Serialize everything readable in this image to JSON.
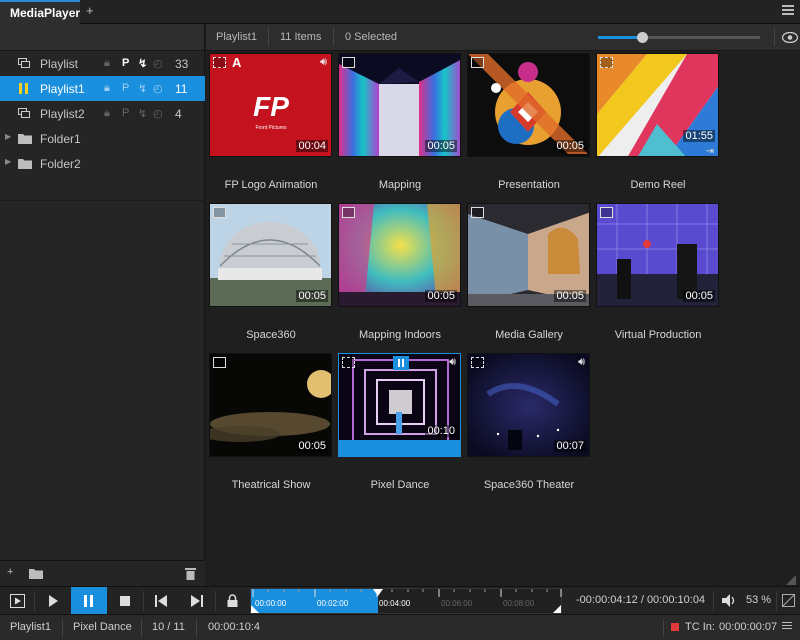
{
  "app": {
    "tab_label": "MediaPlayer",
    "add_tab": "+"
  },
  "sidebar": {
    "items": [
      {
        "label": "Playlist",
        "count": "33",
        "p": "P",
        "type": "playlist",
        "selected": false
      },
      {
        "label": "Playlist1",
        "count": "11",
        "p": "P",
        "type": "playlist-playing",
        "selected": true
      },
      {
        "label": "Playlist2",
        "count": "4",
        "p": "P",
        "type": "playlist",
        "selected": false
      },
      {
        "label": "Folder1",
        "type": "folder"
      },
      {
        "label": "Folder2",
        "type": "folder"
      }
    ]
  },
  "header": {
    "playlist_name": "Playlist1",
    "items_count": "11 Items",
    "selected_count": "0 Selected",
    "thumb_zoom": 0.27
  },
  "media": [
    {
      "title": "FP Logo Animation",
      "duration": "00:04",
      "kind": "video"
    },
    {
      "title": "Mapping",
      "duration": "00:05",
      "kind": "image"
    },
    {
      "title": "Presentation",
      "duration": "00:05",
      "kind": "image"
    },
    {
      "title": "Demo Reel",
      "duration": "01:55",
      "kind": "video"
    },
    {
      "title": "Space360",
      "duration": "00:05",
      "kind": "image"
    },
    {
      "title": "Mapping Indoors",
      "duration": "00:05",
      "kind": "image"
    },
    {
      "title": "Media Gallery",
      "duration": "00:05",
      "kind": "image"
    },
    {
      "title": "Virtual Production",
      "duration": "00:05",
      "kind": "image"
    },
    {
      "title": "Theatrical Show",
      "duration": "00:05",
      "kind": "image"
    },
    {
      "title": "Pixel Dance",
      "duration": "00:10",
      "kind": "video",
      "playing": true
    },
    {
      "title": "Space360 Theater",
      "duration": "00:07",
      "kind": "video"
    }
  ],
  "logo_text": {
    "mark": "FP",
    "caption": "Front Pictures"
  },
  "transport": {
    "ticks": [
      "00:00:00",
      "00:02:00",
      "00:04:00",
      "00:06:00",
      "00:08:00"
    ],
    "played_fraction": 0.41,
    "timecode": "-00:00:04:12 / 00:00:10:04",
    "volume": "53 %"
  },
  "status": {
    "playlist": "Playlist1",
    "current": "Pixel Dance",
    "position": "10 / 11",
    "elapsed": "00:00:10:4",
    "tc_label": "TC In:",
    "tc_value": "00:00:00:07"
  },
  "colors": {
    "accent": "#1a8fdd",
    "tc_indicator": "#e03a3a"
  }
}
